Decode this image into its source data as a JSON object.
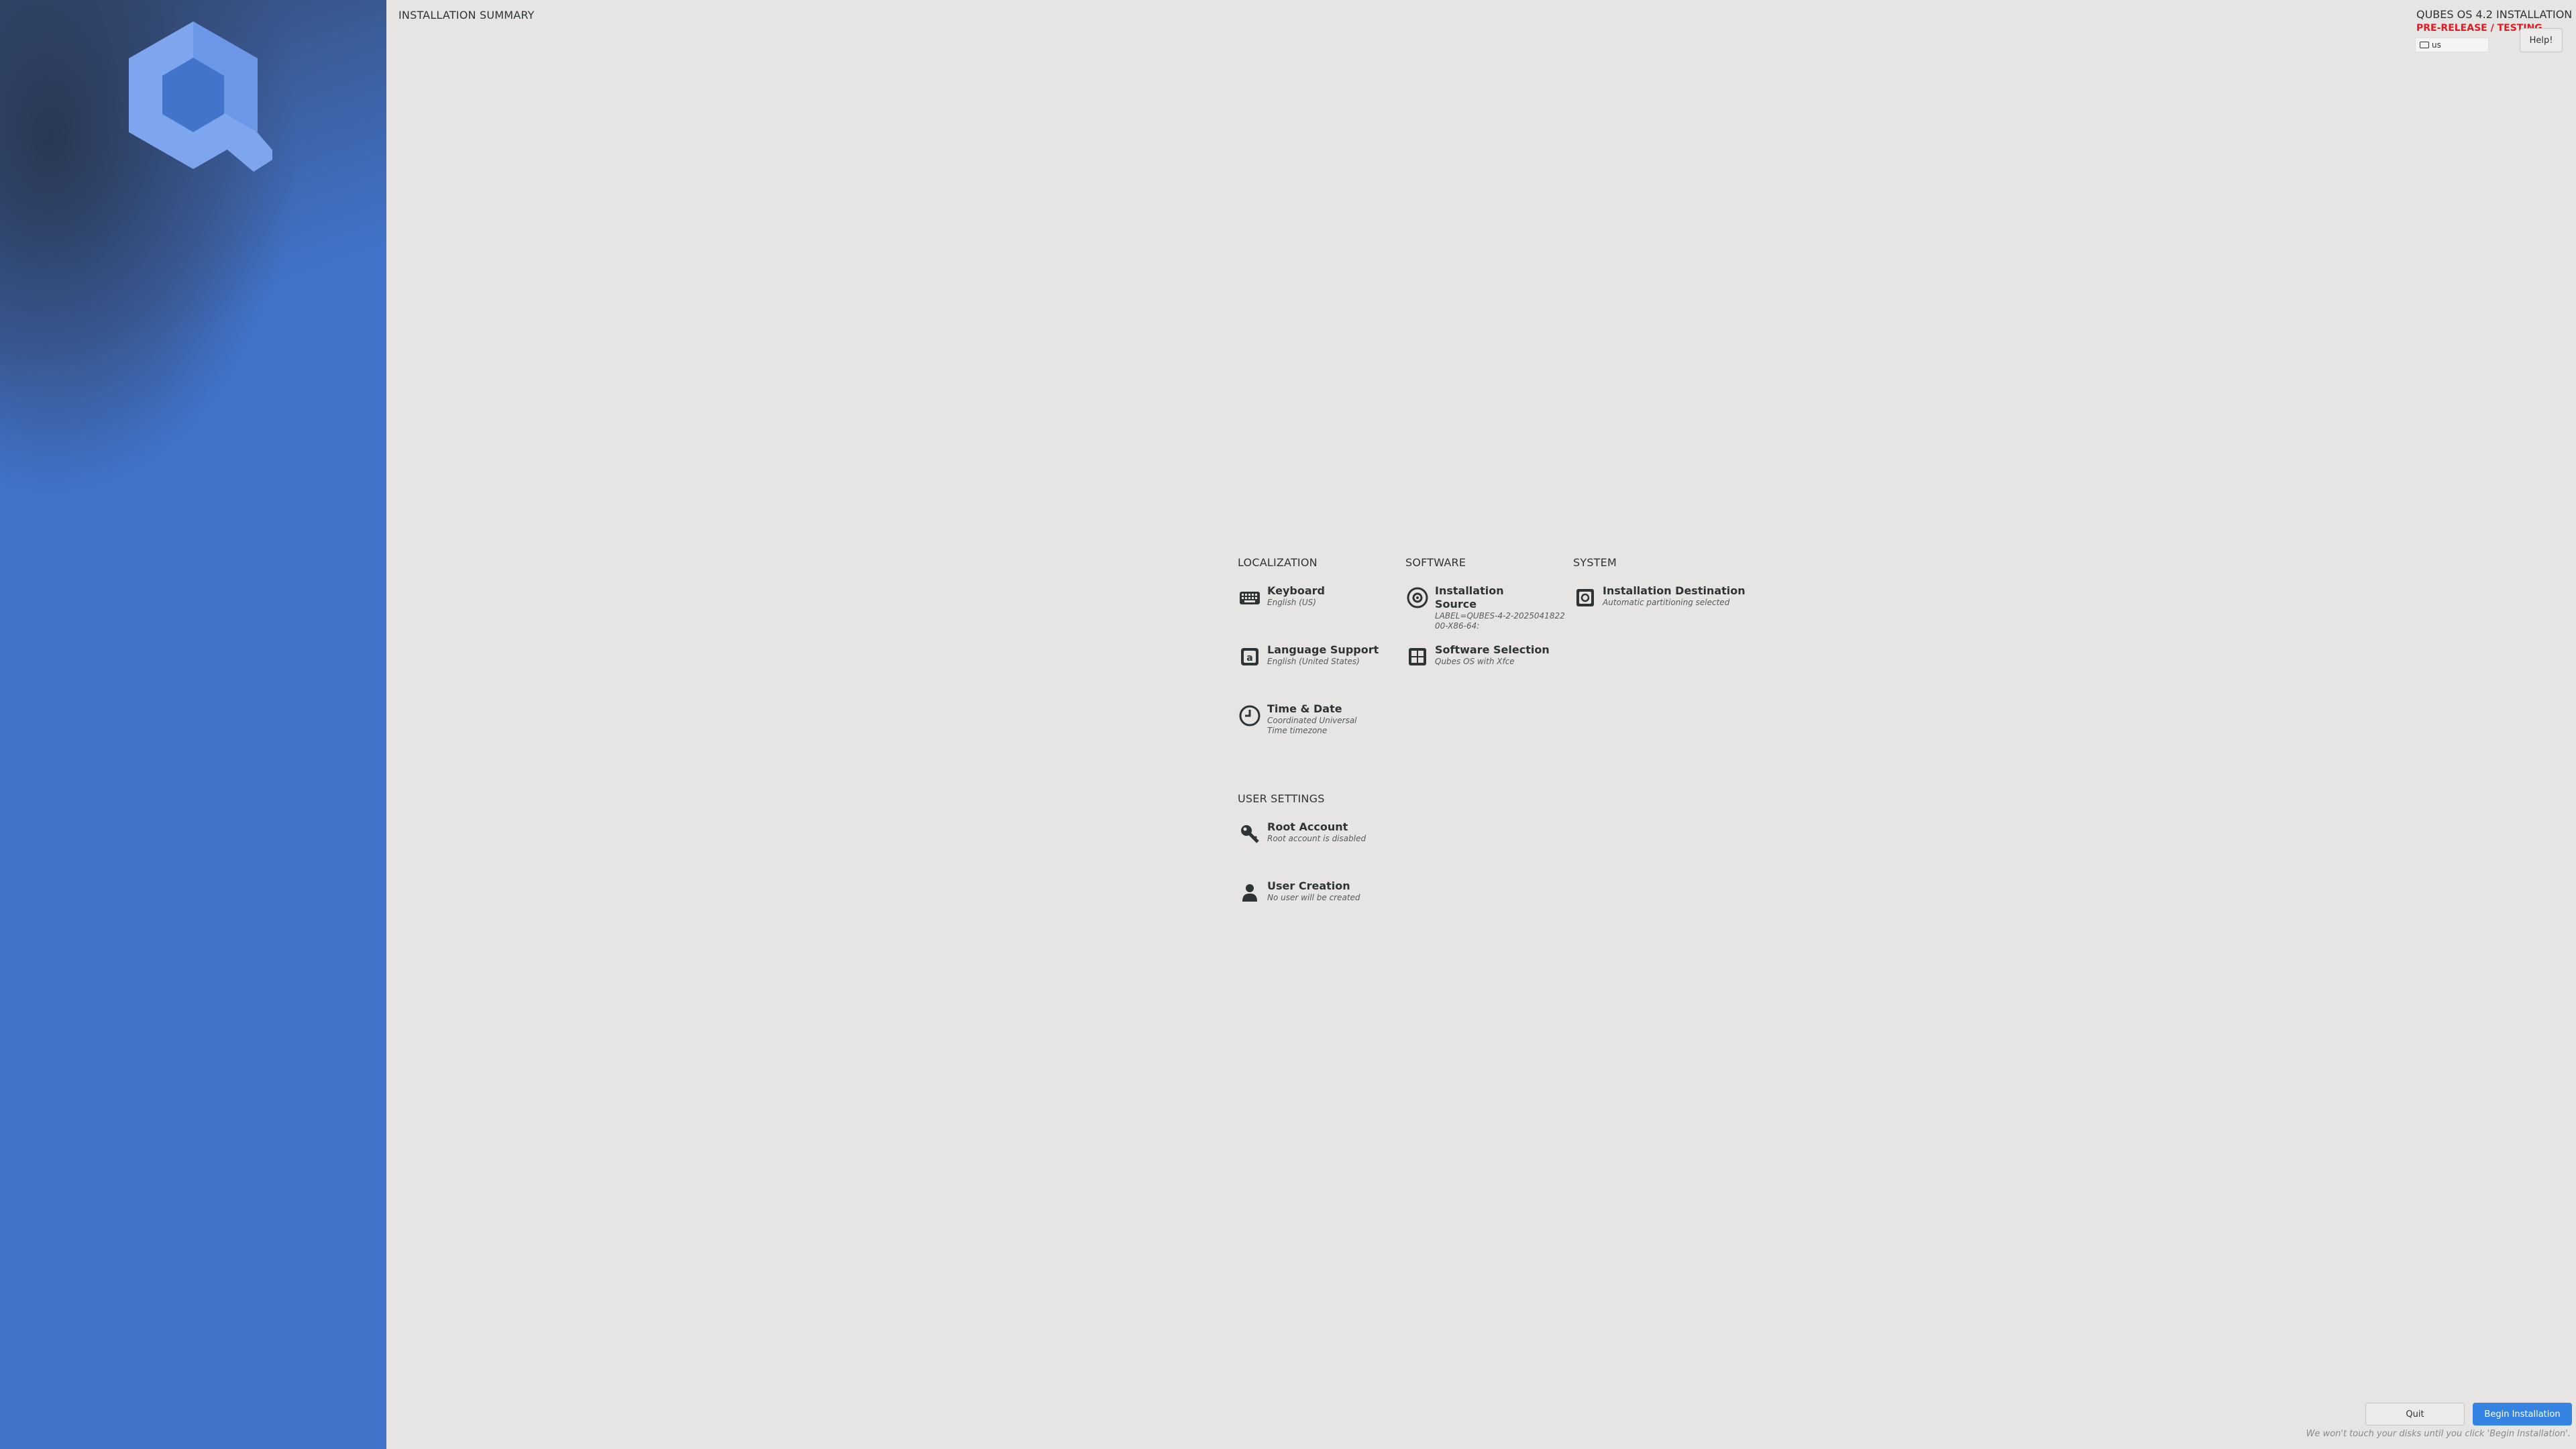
{
  "header": {
    "title": "INSTALLATION SUMMARY",
    "product": "QUBES OS 4.2 INSTALLATION",
    "beta_label": "PRE-RELEASE / TESTING",
    "keyboard_layout": "us",
    "help_label": "Help!"
  },
  "colors": {
    "sidebar": "#4274cc",
    "accent": "#3584e4",
    "beta": "#e01b24",
    "background": "#e6e5e3"
  },
  "sections": {
    "localization": {
      "title": "LOCALIZATION",
      "keyboard": {
        "name": "Keyboard",
        "status": "English (US)",
        "icon": "keyboard-icon"
      },
      "language": {
        "name": "Language Support",
        "status": "English (United States)",
        "icon": "language-icon"
      },
      "time": {
        "name": "Time & Date",
        "status": "Coordinated Universal Time timezone",
        "icon": "clock-icon"
      }
    },
    "software": {
      "title": "SOFTWARE",
      "source": {
        "name": "Installation Source",
        "status": "LABEL=QUBES-4-2-202504182200-X86-64:",
        "icon": "disc-icon"
      },
      "selection": {
        "name": "Software Selection",
        "status": "Qubes OS with Xfce",
        "icon": "package-icon"
      }
    },
    "system": {
      "title": "SYSTEM",
      "destination": {
        "name": "Installation Destination",
        "status": "Automatic partitioning selected",
        "icon": "drive-icon"
      }
    },
    "user_settings": {
      "title": "USER SETTINGS",
      "root": {
        "name": "Root Account",
        "status": "Root account is disabled",
        "icon": "key-icon"
      },
      "user": {
        "name": "User Creation",
        "status": "No user will be created",
        "icon": "user-icon"
      }
    }
  },
  "footer": {
    "quit_label": "Quit",
    "begin_label": "Begin Installation",
    "warning": "We won't touch your disks until you click 'Begin Installation'."
  }
}
